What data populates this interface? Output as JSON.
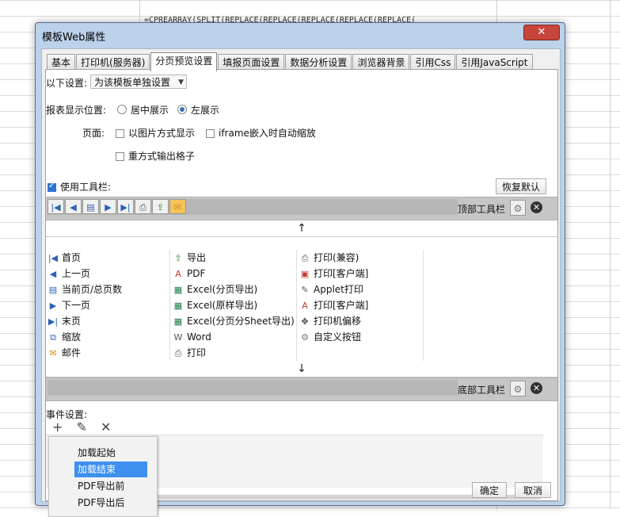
{
  "background": {
    "formula": "=CPREARRAY(SPLIT(REPLACE(REPLACE(REPLACE(REPLACE(REPLACE("
  },
  "dialog": {
    "title": "模板Web属性",
    "close_glyph": "✕",
    "tabs": [
      "基本",
      "打印机(服务器)",
      "分页预览设置",
      "填报页面设置",
      "数据分析设置",
      "浏览器背景",
      "引用Css",
      "引用JavaScript"
    ],
    "active_tab": "分页预览设置",
    "settings_label": "以下设置:",
    "settings_value": "为该模板单独设置",
    "position_label": "报表显示位置:",
    "position_center": "居中展示",
    "position_left": "左展示",
    "page_label": "页面:",
    "page_image": "以图片方式显示",
    "page_iframe": "iframe嵌入时自动缩放",
    "page_grid": "重方式输出格子",
    "use_toolbar": "使用工具栏:",
    "restore_default": "恢复默认",
    "top_toolbar": "顶部工具栏",
    "bottom_toolbar": "底部工具栏",
    "up_arrow": "↑",
    "down_arrow": "↓",
    "toolbar_icons": [
      "first-page-icon",
      "prev-page-icon",
      "page-count-icon",
      "next-page-icon",
      "last-page-icon",
      "print-icon",
      "export-icon",
      "email-icon"
    ],
    "toolbar_buttons": [
      [
        "首页",
        "导出",
        "打印(兼容)"
      ],
      [
        "上一页",
        "PDF",
        "打印[客户端]"
      ],
      [
        "当前页/总页数",
        "Excel(分页导出)",
        "Applet打印"
      ],
      [
        "下一页",
        "Excel(原样导出)",
        "打印[客户端]"
      ],
      [
        "末页",
        "Excel(分页分Sheet导出)",
        "打印机偏移"
      ],
      [
        "缩放",
        "Word",
        "自定义按钮"
      ],
      [
        "邮件",
        "打印",
        ""
      ]
    ],
    "event_label": "事件设置:",
    "event_add": "+",
    "event_edit": "✎",
    "event_delete": "✕",
    "event_menu": [
      "加载起始",
      "加载结束",
      "PDF导出前",
      "PDF导出后"
    ],
    "event_menu_selected": "加载结束",
    "ok": "确定",
    "cancel": "取消"
  }
}
